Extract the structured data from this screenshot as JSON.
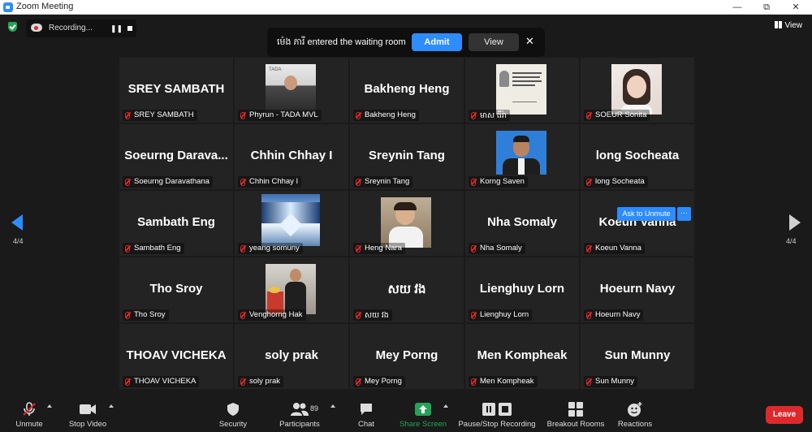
{
  "window": {
    "title": "Zoom Meeting",
    "minimize": "—",
    "restore": "⧉",
    "close": "✕"
  },
  "recording": {
    "label": "Recording...",
    "pause": "❚❚"
  },
  "view_button": {
    "label": "View"
  },
  "waiting_room": {
    "message": "ម៉េង ភារី entered the waiting room",
    "admit": "Admit",
    "view": "View",
    "close": "✕"
  },
  "pagination": {
    "left": "4/4",
    "right": "4/4"
  },
  "participants": [
    {
      "display": "SREY SAMBATH",
      "name": "SREY SAMBATH"
    },
    {
      "display": "",
      "name": "Phyrun - TADA MVL"
    },
    {
      "display": "Bakheng Heng",
      "name": "Bakheng Heng"
    },
    {
      "display": "",
      "name": "មាស ធីរ៉ា"
    },
    {
      "display": "",
      "name": "SOEUR Sonita"
    },
    {
      "display": "Soeurng Darava...",
      "name": "Soeurng Daravathana"
    },
    {
      "display": "Chhin Chhay I",
      "name": "Chhin Chhay I"
    },
    {
      "display": "Sreynin Tang",
      "name": "Sreynin Tang"
    },
    {
      "display": "",
      "name": "Korng Saven"
    },
    {
      "display": "long Socheata",
      "name": "long Socheata"
    },
    {
      "display": "Sambath Eng",
      "name": "Sambath Eng"
    },
    {
      "display": "",
      "name": "yeang somuny"
    },
    {
      "display": "",
      "name": "Heng Nara"
    },
    {
      "display": "Nha Somaly",
      "name": "Nha Somaly"
    },
    {
      "display": "Koeun Vanna",
      "name": "Koeun Vanna"
    },
    {
      "display": "Tho Sroy",
      "name": "Tho Sroy"
    },
    {
      "display": "",
      "name": "Venghorng Hak"
    },
    {
      "display": "សយ វង",
      "name": "សយ វង"
    },
    {
      "display": "Lienghuy Lorn",
      "name": "Lienghuy Lorn"
    },
    {
      "display": "Hoeurn Navy",
      "name": "Hoeurn Navy"
    },
    {
      "display": "THOAV VICHEKA",
      "name": "THOAV VICHEKA"
    },
    {
      "display": "soly prak",
      "name": "soly prak"
    },
    {
      "display": "Mey Porng",
      "name": "Mey Porng"
    },
    {
      "display": "Men Kompheak",
      "name": "Men Kompheak"
    },
    {
      "display": "Sun Munny",
      "name": "Sun Munny"
    }
  ],
  "tile_actions": {
    "ask_to_unmute": "Ask to Unmute",
    "more": "···"
  },
  "toolbar": {
    "unmute": "Unmute",
    "stop_video": "Stop Video",
    "security": "Security",
    "participants": "Participants",
    "participants_count": "89",
    "chat": "Chat",
    "share_screen": "Share Screen",
    "pause_stop_recording": "Pause/Stop Recording",
    "breakout_rooms": "Breakout Rooms",
    "reactions": "Reactions",
    "leave": "Leave"
  },
  "colors": {
    "accent": "#2d8cff",
    "danger": "#e0282b",
    "share_green": "#23a455",
    "tile_bg": "#232323"
  }
}
